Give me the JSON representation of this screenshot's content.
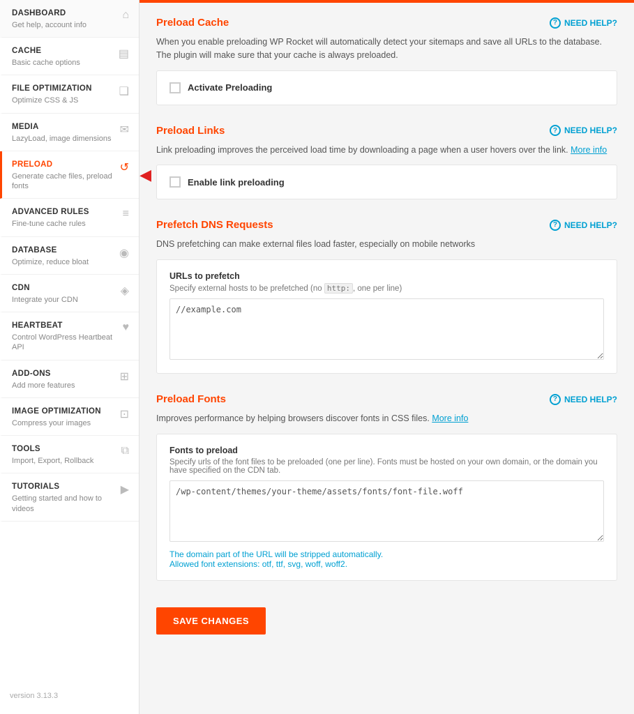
{
  "sidebar": {
    "items": [
      {
        "id": "dashboard",
        "title": "DASHBOARD",
        "sub": "Get help, account info",
        "icon": "🏠",
        "active": false
      },
      {
        "id": "cache",
        "title": "CACHE",
        "sub": "Basic cache options",
        "icon": "📄",
        "active": false
      },
      {
        "id": "file-optimization",
        "title": "FILE OPTIMIZATION",
        "sub": "Optimize CSS & JS",
        "icon": "📚",
        "active": false
      },
      {
        "id": "media",
        "title": "MEDIA",
        "sub": "LazyLoad, image dimensions",
        "icon": "✉",
        "active": false
      },
      {
        "id": "preload",
        "title": "PRELOAD",
        "sub": "Generate cache files, preload fonts",
        "icon": "↺",
        "active": true
      },
      {
        "id": "advanced-rules",
        "title": "ADVANCED RULES",
        "sub": "Fine-tune cache rules",
        "icon": "≡",
        "active": false
      },
      {
        "id": "database",
        "title": "DATABASE",
        "sub": "Optimize, reduce bloat",
        "icon": "🗄",
        "active": false
      },
      {
        "id": "cdn",
        "title": "CDN",
        "sub": "Integrate your CDN",
        "icon": "🌐",
        "active": false
      },
      {
        "id": "heartbeat",
        "title": "HEARTBEAT",
        "sub": "Control WordPress Heartbeat API",
        "icon": "♥",
        "active": false
      },
      {
        "id": "add-ons",
        "title": "ADD-ONS",
        "sub": "Add more features",
        "icon": "🧩",
        "active": false
      },
      {
        "id": "image-optimization",
        "title": "IMAGE OPTIMIZATION",
        "sub": "Compress your images",
        "icon": "🖼",
        "active": false
      },
      {
        "id": "tools",
        "title": "TOOLS",
        "sub": "Import, Export, Rollback",
        "icon": "📋",
        "active": false
      },
      {
        "id": "tutorials",
        "title": "TUTORIALS",
        "sub": "Getting started and how to videos",
        "icon": "▶",
        "active": false
      }
    ],
    "version": "version 3.13.3"
  },
  "main": {
    "sections": [
      {
        "id": "preload-cache",
        "title": "Preload Cache",
        "need_help": "NEED HELP?",
        "description": "When you enable preloading WP Rocket will automatically detect your sitemaps and save all URLs to the database. The plugin will make sure that your cache is always preloaded.",
        "checkbox_label": "Activate Preloading",
        "checked": false
      },
      {
        "id": "preload-links",
        "title": "Preload Links",
        "need_help": "NEED HELP?",
        "description": "Link preloading improves the perceived load time by downloading a page when a user hovers over the link.",
        "description_link": "More info",
        "checkbox_label": "Enable link preloading",
        "checked": false
      },
      {
        "id": "prefetch-dns",
        "title": "Prefetch DNS Requests",
        "need_help": "NEED HELP?",
        "description": "DNS prefetching can make external files load faster, especially on mobile networks",
        "field_label": "URLs to prefetch",
        "field_sub_before": "Specify external hosts to be prefetched (no",
        "field_code": "http:",
        "field_sub_after": ", one per line)",
        "textarea_placeholder": "//example.com",
        "textarea_value": "//example.com",
        "textarea_rows": 5
      },
      {
        "id": "preload-fonts",
        "title": "Preload Fonts",
        "need_help": "NEED HELP?",
        "description": "Improves performance by helping browsers discover fonts in CSS files.",
        "description_link": "More info",
        "field_label": "Fonts to preload",
        "field_sub": "Specify urls of the font files to be preloaded (one per line). Fonts must be hosted on your own domain, or the domain you have specified on the CDN tab.",
        "textarea_placeholder": "/wp-content/themes/your-theme/assets/fonts/font-file.woff",
        "textarea_value": "/wp-content/themes/your-theme/assets/fonts/font-file.woff",
        "textarea_rows": 5,
        "notice": "The domain part of the URL will be stripped automatically.",
        "notice2": "Allowed font extensions: otf, ttf, svg, woff, woff2."
      }
    ],
    "save_button": "SAVE CHANGES"
  }
}
